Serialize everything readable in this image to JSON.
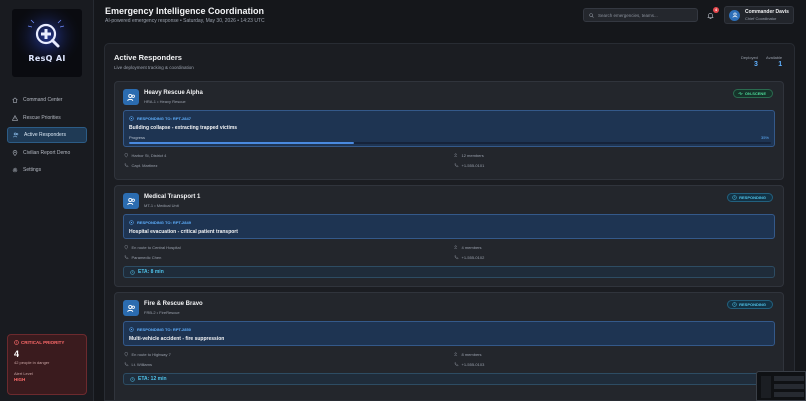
{
  "app": {
    "logo_text": "ResQ AI",
    "title": "Emergency Intelligence Coordination",
    "subtitle": "AI-powered emergency response • Saturday, May 30, 2026 • 14:23 UTC"
  },
  "sidebar": {
    "items": [
      {
        "label": "Command Center",
        "icon": "home-icon"
      },
      {
        "label": "Rescue Priorities",
        "icon": "alert-triangle-icon"
      },
      {
        "label": "Active Responders",
        "icon": "users-icon",
        "active": true
      },
      {
        "label": "Civilian Report Demo",
        "icon": "map-pin-icon"
      },
      {
        "label": "Settings",
        "icon": "gear-icon"
      }
    ],
    "critical": {
      "title": "CRITICAL PRIORITY",
      "count": "4",
      "people": "42 people in danger",
      "alert_label": "Alert Level",
      "alert_value": "HIGH"
    }
  },
  "header": {
    "search_placeholder": "Search emergencies, teams...",
    "notification_count": "4",
    "user_name": "Commander Davis",
    "user_role": "Chief Coordinator"
  },
  "main": {
    "title": "Active Responders",
    "subtitle": "Live deployment tracking & coordination",
    "stats": {
      "deployed_label": "Deployed",
      "deployed_value": "3",
      "available_label": "Available",
      "available_value": "1"
    },
    "responders": [
      {
        "name": "Heavy Rescue Alpha",
        "code": "HRA-1 • Heavy Rescue",
        "status": "ON-SCENE",
        "responding_to": "RESPONDING TO: RPT-2847",
        "description": "Building collapse - extracting trapped victims",
        "progress_label": "Progress",
        "progress_text": "35%",
        "progress": 0.35,
        "location": "Harbor St, District 4",
        "members": "12 members",
        "leader": "Capt. Martinez",
        "phone": "+1-555-0101"
      },
      {
        "name": "Medical Transport 1",
        "code": "MT-1 • Medical Unit",
        "status": "RESPONDING",
        "responding_to": "RESPONDING TO: RPT-2849",
        "description": "Hospital evacuation - critical patient transport",
        "location": "En route to Central Hospital",
        "members": "4 members",
        "leader": "Paramedic Chen",
        "phone": "+1-555-0102",
        "eta": "ETA: 8 min"
      },
      {
        "name": "Fire & Rescue Bravo",
        "code": "FRB-2 • FireRescue",
        "status": "RESPONDING",
        "responding_to": "RESPONDING TO: RPT-2850",
        "description": "Multi-vehicle accident - fire suppression",
        "location": "En route to Highway 7",
        "members": "8 members",
        "leader": "Lt. Williams",
        "phone": "+1-555-0103",
        "eta": "ETA: 12 min"
      }
    ]
  }
}
